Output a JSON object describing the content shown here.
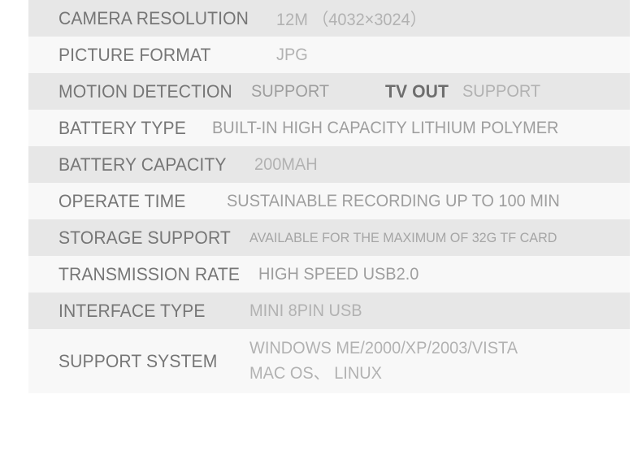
{
  "spec_sheet": {
    "rows": [
      {
        "label": "CAMERA RESOLUTION",
        "value": "12M （4032×3024）"
      },
      {
        "label": "PICTURE FORMAT",
        "value": "JPG"
      },
      {
        "label": "MOTION DETECTION",
        "value": "SUPPORT",
        "label2": "TV OUT",
        "value2": "SUPPORT"
      },
      {
        "label": "BATTERY TYPE",
        "value": "BUILT-IN HIGH CAPACITY LITHIUM POLYMER"
      },
      {
        "label": "BATTERY CAPACITY",
        "value": "200MAH"
      },
      {
        "label": "OPERATE TIME",
        "value": "SUSTAINABLE RECORDING UP TO 100 MIN"
      },
      {
        "label": "STORAGE SUPPORT",
        "value": "AVAILABLE FOR THE MAXIMUM OF 32G TF CARD"
      },
      {
        "label": "TRANSMISSION RATE",
        "value": "HIGH SPEED USB2.0"
      },
      {
        "label": "INTERFACE TYPE",
        "value": "MINI 8PIN USB"
      },
      {
        "label": "SUPPORT SYSTEM",
        "value": "WINDOWS ME/2000/XP/2003/VISTA\nMAC OS、 LINUX"
      }
    ],
    "colors": {
      "row_shade_dark": "#e7e7e7",
      "row_shade_light": "#f8f8f8",
      "label_text": "#767676",
      "value_text": "#a8a8a8",
      "page_background": "#ffffff"
    }
  }
}
